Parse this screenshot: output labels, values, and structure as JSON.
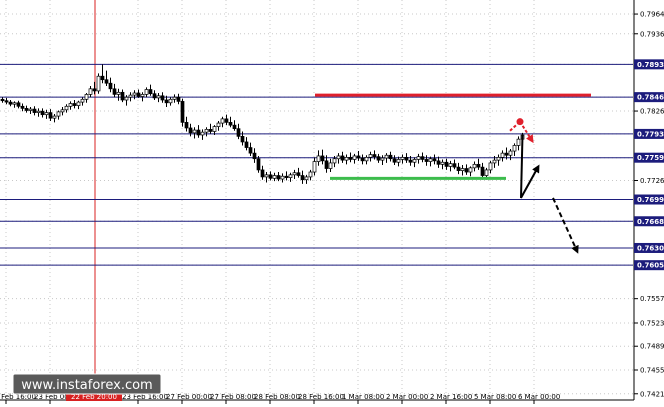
{
  "watermark": "www.instaforex.com",
  "highlighted_date": "22 Feb 20:00",
  "colors": {
    "background": "#ffffff",
    "grid": "#c8c8c8",
    "levels": "#1c1c7c",
    "label_bg": "#1c1c7c",
    "resistance": "#e0202c",
    "support": "#3cbc4c",
    "vline": "#d82020",
    "candle": "#000000",
    "watermark_bg": "#5a5a5a",
    "highlight_bg": "#d82020",
    "scenario_main": "#000000",
    "scenario_alt": "#e0202c"
  },
  "chart_data": {
    "type": "candlestick",
    "y_range": [
      0.7413,
      0.7985
    ],
    "y_ticks": [
      "0.79649",
      "0.79367",
      "0.78930",
      "0.78461",
      "0.78262",
      "0.77935",
      "0.77595",
      "0.77269",
      "0.76997",
      "0.76686",
      "0.76304",
      "0.76058",
      "0.75579",
      "0.75231",
      "0.74899",
      "0.74559",
      "0.74219"
    ],
    "level_labels": [
      "0.78930",
      "0.78461",
      "0.77935",
      "0.77595",
      "0.76997",
      "0.76686",
      "0.76304",
      "0.76058"
    ],
    "x_labels": [
      "22 Feb 16:00",
      "23 Feb 00:00",
      "23 Feb 16:00",
      "27 Feb 00:00",
      "27 Feb 08:00",
      "28 Feb 08:00",
      "28 Feb 16:00",
      "1 Mar 08:00",
      "2 Mar 00:00",
      "2 Mar 16:00",
      "5 Mar 08:00",
      "6 Mar 00:00"
    ],
    "resistance_level": 0.7849,
    "support_level": 0.773,
    "candles": [
      [
        0.7843,
        0.7846,
        0.7838,
        0.7841
      ],
      [
        0.7841,
        0.7845,
        0.7836,
        0.7839
      ],
      [
        0.7839,
        0.7842,
        0.7833,
        0.7836
      ],
      [
        0.7836,
        0.784,
        0.7831,
        0.7838
      ],
      [
        0.7838,
        0.7841,
        0.783,
        0.7833
      ],
      [
        0.7833,
        0.7837,
        0.7826,
        0.783
      ],
      [
        0.783,
        0.7834,
        0.7824,
        0.7827
      ],
      [
        0.7827,
        0.7832,
        0.7822,
        0.7829
      ],
      [
        0.7829,
        0.7833,
        0.782,
        0.7824
      ],
      [
        0.7824,
        0.783,
        0.7818,
        0.7826
      ],
      [
        0.7826,
        0.783,
        0.7817,
        0.7821
      ],
      [
        0.7821,
        0.7828,
        0.7815,
        0.7824
      ],
      [
        0.7824,
        0.7829,
        0.7812,
        0.7816
      ],
      [
        0.7816,
        0.7822,
        0.781,
        0.7819
      ],
      [
        0.7819,
        0.7827,
        0.7814,
        0.7825
      ],
      [
        0.7825,
        0.7832,
        0.782,
        0.7828
      ],
      [
        0.7828,
        0.7836,
        0.7824,
        0.7833
      ],
      [
        0.7833,
        0.784,
        0.7828,
        0.7837
      ],
      [
        0.7837,
        0.7842,
        0.783,
        0.7834
      ],
      [
        0.7834,
        0.7841,
        0.7829,
        0.7839
      ],
      [
        0.7839,
        0.7846,
        0.7834,
        0.7843
      ],
      [
        0.7843,
        0.7852,
        0.7838,
        0.785
      ],
      [
        0.785,
        0.7862,
        0.7846,
        0.7858
      ],
      [
        0.7858,
        0.7868,
        0.785,
        0.7855
      ],
      [
        0.7855,
        0.788,
        0.7851,
        0.7876
      ],
      [
        0.7876,
        0.7893,
        0.7866,
        0.7871
      ],
      [
        0.7871,
        0.7884,
        0.7862,
        0.7866
      ],
      [
        0.7866,
        0.7874,
        0.7853,
        0.7858
      ],
      [
        0.7858,
        0.7865,
        0.7846,
        0.785
      ],
      [
        0.785,
        0.7858,
        0.7841,
        0.7853
      ],
      [
        0.7853,
        0.7857,
        0.7839,
        0.7842
      ],
      [
        0.7842,
        0.7849,
        0.7834,
        0.7846
      ],
      [
        0.7846,
        0.7853,
        0.784,
        0.7849
      ],
      [
        0.7849,
        0.7856,
        0.7843,
        0.7852
      ],
      [
        0.7852,
        0.7857,
        0.7845,
        0.7847
      ],
      [
        0.7847,
        0.7853,
        0.784,
        0.785
      ],
      [
        0.785,
        0.786,
        0.7846,
        0.7857
      ],
      [
        0.7857,
        0.7864,
        0.7848,
        0.7851
      ],
      [
        0.7851,
        0.7856,
        0.7842,
        0.7845
      ],
      [
        0.7845,
        0.7852,
        0.7839,
        0.7848
      ],
      [
        0.7848,
        0.7853,
        0.7838,
        0.7842
      ],
      [
        0.7842,
        0.7848,
        0.7832,
        0.7838
      ],
      [
        0.7838,
        0.7846,
        0.7834,
        0.7843
      ],
      [
        0.7843,
        0.785,
        0.7838,
        0.7846
      ],
      [
        0.7846,
        0.7851,
        0.7836,
        0.784
      ],
      [
        0.784,
        0.7844,
        0.7804,
        0.781
      ],
      [
        0.781,
        0.7818,
        0.7797,
        0.7802
      ],
      [
        0.7802,
        0.7808,
        0.779,
        0.7795
      ],
      [
        0.7795,
        0.7803,
        0.7787,
        0.7799
      ],
      [
        0.7799,
        0.7806,
        0.7788,
        0.7792
      ],
      [
        0.7792,
        0.78,
        0.7785,
        0.7796
      ],
      [
        0.7796,
        0.7803,
        0.779,
        0.78
      ],
      [
        0.78,
        0.7808,
        0.7794,
        0.7797
      ],
      [
        0.7797,
        0.7806,
        0.7792,
        0.7804
      ],
      [
        0.7804,
        0.7812,
        0.7798,
        0.7809
      ],
      [
        0.7809,
        0.7818,
        0.7803,
        0.7815
      ],
      [
        0.7815,
        0.7821,
        0.7806,
        0.781
      ],
      [
        0.781,
        0.7818,
        0.7803,
        0.7806
      ],
      [
        0.7806,
        0.7813,
        0.7798,
        0.7801
      ],
      [
        0.7801,
        0.7808,
        0.7786,
        0.779
      ],
      [
        0.779,
        0.7797,
        0.7777,
        0.7782
      ],
      [
        0.7782,
        0.7789,
        0.777,
        0.7774
      ],
      [
        0.7774,
        0.7781,
        0.7762,
        0.7766
      ],
      [
        0.7766,
        0.7773,
        0.7752,
        0.7758
      ],
      [
        0.7758,
        0.7762,
        0.7738,
        0.7742
      ],
      [
        0.7742,
        0.7748,
        0.7728,
        0.7732
      ],
      [
        0.7732,
        0.7739,
        0.7724,
        0.7735
      ],
      [
        0.7735,
        0.774,
        0.7727,
        0.773
      ],
      [
        0.773,
        0.7738,
        0.7726,
        0.7734
      ],
      [
        0.7734,
        0.7739,
        0.7726,
        0.7729
      ],
      [
        0.7729,
        0.7737,
        0.7724,
        0.7733
      ],
      [
        0.7733,
        0.774,
        0.7727,
        0.7731
      ],
      [
        0.7731,
        0.7738,
        0.7725,
        0.7735
      ],
      [
        0.7735,
        0.7742,
        0.7729,
        0.7738
      ],
      [
        0.7738,
        0.7745,
        0.7731,
        0.7734
      ],
      [
        0.7734,
        0.7741,
        0.7722,
        0.7728
      ],
      [
        0.7728,
        0.7735,
        0.7722,
        0.7732
      ],
      [
        0.7732,
        0.7742,
        0.7727,
        0.7739
      ],
      [
        0.7739,
        0.776,
        0.7734,
        0.7754
      ],
      [
        0.7754,
        0.777,
        0.7748,
        0.7762
      ],
      [
        0.7762,
        0.7771,
        0.775,
        0.7755
      ],
      [
        0.7755,
        0.7763,
        0.7738,
        0.7744
      ],
      [
        0.7744,
        0.7758,
        0.7739,
        0.7752
      ],
      [
        0.7752,
        0.7762,
        0.7746,
        0.7758
      ],
      [
        0.7758,
        0.7766,
        0.7751,
        0.7762
      ],
      [
        0.7762,
        0.7768,
        0.7752,
        0.7756
      ],
      [
        0.7756,
        0.7764,
        0.775,
        0.776
      ],
      [
        0.776,
        0.7767,
        0.7753,
        0.7757
      ],
      [
        0.7757,
        0.7765,
        0.7751,
        0.7762
      ],
      [
        0.7762,
        0.7769,
        0.7755,
        0.7759
      ],
      [
        0.7759,
        0.7764,
        0.775,
        0.7755
      ],
      [
        0.7755,
        0.7763,
        0.775,
        0.776
      ],
      [
        0.776,
        0.7768,
        0.7754,
        0.7764
      ],
      [
        0.7764,
        0.777,
        0.7757,
        0.7761
      ],
      [
        0.7761,
        0.7765,
        0.7752,
        0.7756
      ],
      [
        0.7756,
        0.7763,
        0.7749,
        0.7759
      ],
      [
        0.7759,
        0.7766,
        0.7752,
        0.7763
      ],
      [
        0.7763,
        0.7768,
        0.7754,
        0.7758
      ],
      [
        0.7758,
        0.7763,
        0.7749,
        0.7753
      ],
      [
        0.7753,
        0.7761,
        0.7747,
        0.7757
      ],
      [
        0.7757,
        0.7764,
        0.7751,
        0.776
      ],
      [
        0.776,
        0.7766,
        0.7752,
        0.7756
      ],
      [
        0.7756,
        0.7762,
        0.7748,
        0.7753
      ],
      [
        0.7753,
        0.776,
        0.7746,
        0.7757
      ],
      [
        0.7757,
        0.7765,
        0.7751,
        0.7761
      ],
      [
        0.7761,
        0.7767,
        0.7753,
        0.7757
      ],
      [
        0.7757,
        0.7763,
        0.7748,
        0.7754
      ],
      [
        0.7754,
        0.7761,
        0.7747,
        0.7758
      ],
      [
        0.7758,
        0.7764,
        0.775,
        0.7755
      ],
      [
        0.7755,
        0.7761,
        0.7745,
        0.775
      ],
      [
        0.775,
        0.7757,
        0.7743,
        0.7753
      ],
      [
        0.7753,
        0.7758,
        0.7742,
        0.7747
      ],
      [
        0.7747,
        0.7755,
        0.774,
        0.7751
      ],
      [
        0.7751,
        0.7757,
        0.7743,
        0.7746
      ],
      [
        0.7746,
        0.7752,
        0.7736,
        0.7741
      ],
      [
        0.7741,
        0.7749,
        0.7734,
        0.7744
      ],
      [
        0.7744,
        0.775,
        0.7735,
        0.7739
      ],
      [
        0.7739,
        0.7747,
        0.7733,
        0.7745
      ],
      [
        0.7745,
        0.7754,
        0.774,
        0.775
      ],
      [
        0.775,
        0.7758,
        0.7742,
        0.7746
      ],
      [
        0.7746,
        0.7752,
        0.7728,
        0.7734
      ],
      [
        0.7734,
        0.7745,
        0.7728,
        0.7742
      ],
      [
        0.7742,
        0.7755,
        0.7737,
        0.7752
      ],
      [
        0.7752,
        0.7762,
        0.7745,
        0.7756
      ],
      [
        0.7756,
        0.7764,
        0.7748,
        0.776
      ],
      [
        0.776,
        0.777,
        0.7754,
        0.7766
      ],
      [
        0.7766,
        0.7774,
        0.7757,
        0.7763
      ],
      [
        0.7763,
        0.7772,
        0.7756,
        0.7769
      ],
      [
        0.7769,
        0.778,
        0.7762,
        0.7777
      ],
      [
        0.7777,
        0.779,
        0.777,
        0.7786
      ],
      [
        0.7786,
        0.7795,
        0.7778,
        0.7792
      ]
    ],
    "scenario_main": [
      [
        0.7792,
        0.7702
      ],
      [
        0.7684,
        0.7746
      ]
    ],
    "scenario_alt_dashed": [
      [
        0.7702,
        0.7674
      ],
      [
        0.7645,
        0.7626
      ]
    ],
    "scenario_alt_red": [
      [
        0.7798,
        0.7811
      ],
      [
        0.7809,
        0.7784
      ]
    ]
  }
}
